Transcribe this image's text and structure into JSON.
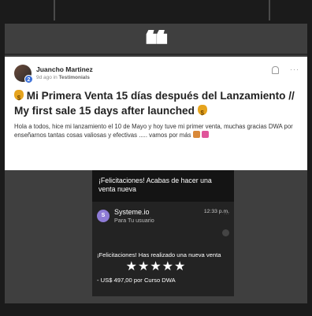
{
  "quote_mark": "❝",
  "post": {
    "author": "Juancho Martinez",
    "meta_time": "9d ago in",
    "meta_category": "Testimonials",
    "avatar_badge": "2",
    "more_label": "···",
    "title": "Mi Primera Venta 15 días después del Lanzamiento // My first sale 15 days after launched",
    "body": "Hola a todos, hice mi lanzamiento el 10 de Mayo y hoy tuve mi primer venta, muchas gracias DWA por enseñarnos tantas cosas valiosas y efectivas ..... vamos por más"
  },
  "notification": {
    "headline": "¡Felicitaciones! Acabas de hacer una venta nueva",
    "sender_initial": "S",
    "sender": "Systeme.io",
    "time": "12:33 p.m.",
    "to": "Para Tu usuario",
    "more": "···",
    "message": "¡Felicitaciones! Has realizado una nueva venta",
    "amount": "- US$ 497,00 por Curso DWA"
  },
  "rating": {
    "stars": "★★★★★",
    "value": 5,
    "max": 5
  },
  "icons": {
    "quote": "quote-icon",
    "bell": "bell-icon",
    "bag": "money-bag-icon"
  },
  "colors": {
    "background": "#1b1b1b",
    "panel": "#3f3f3f",
    "bag": "#e6a41e",
    "sender_avatar": "#8e7bd6"
  }
}
